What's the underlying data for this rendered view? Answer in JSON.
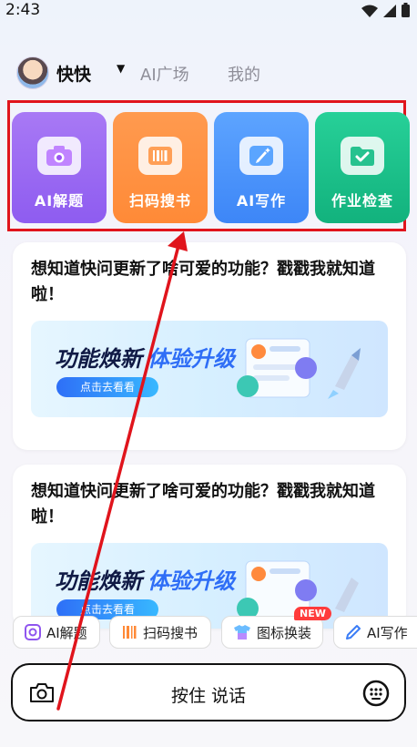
{
  "status": {
    "time": "2:43"
  },
  "nav": {
    "user_name": "快快",
    "tabs": [
      "AI广场",
      "我的"
    ]
  },
  "features": [
    {
      "label": "AI解题",
      "icon": "camera-icon",
      "color": "#9b6af3"
    },
    {
      "label": "扫码搜书",
      "icon": "barcode-icon",
      "color": "#ff9241"
    },
    {
      "label": "AI写作",
      "icon": "pen-icon",
      "color": "#4b93fa"
    },
    {
      "label": "作业检查",
      "icon": "folder-check-icon",
      "color": "#1cc08a"
    }
  ],
  "cards": [
    {
      "text": "想知道快问更新了啥可爱的功能？戳戳我就知道啦！",
      "banner_title_1": "功能焕新",
      "banner_title_2": "体验升级",
      "banner_button": "点击去看看"
    },
    {
      "text": "想知道快问更新了啥可爱的功能？戳戳我就知道啦！",
      "banner_title_1": "功能焕新",
      "banner_title_2": "体验升级",
      "banner_button": "点击去看看"
    }
  ],
  "quick_actions": [
    {
      "label": "AI解题",
      "icon": "camera-icon"
    },
    {
      "label": "扫码搜书",
      "icon": "barcode-icon"
    },
    {
      "label": "图标换装",
      "icon": "shirt-icon",
      "badge": "NEW"
    },
    {
      "label": "AI写作",
      "icon": "pen-icon"
    }
  ],
  "input_bar": {
    "label": "按住 说话"
  },
  "annotation": {
    "highlight_color": "#e0141c"
  }
}
